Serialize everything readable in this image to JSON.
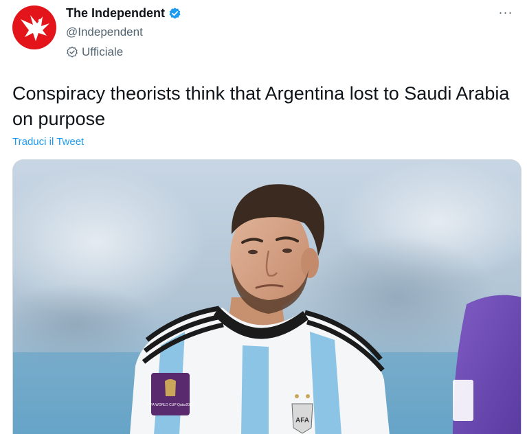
{
  "author": {
    "name": "The Independent",
    "handle": "@Independent",
    "label": "Ufficiale",
    "avatar_icon": "eagle-logo-icon",
    "verified_icon": "verified-badge-icon",
    "official_icon": "official-badge-icon"
  },
  "menu": {
    "icon": "more-options-icon",
    "label": "···"
  },
  "tweet": {
    "text": "Conspiracy theorists think that Argentina lost to Saudi Arabia on purpose",
    "translate_label": "Traduci il Tweet"
  },
  "media": {
    "type": "photo",
    "shirt_badge_text": "FIFA WORLD CUP Qatar2022",
    "crest_text": "AFA"
  },
  "colors": {
    "brand_red": "#e3151a",
    "link_blue": "#1d9bf0",
    "verified_blue": "#1d9bf0",
    "text_secondary": "#536471",
    "text_primary": "#0f1419"
  }
}
